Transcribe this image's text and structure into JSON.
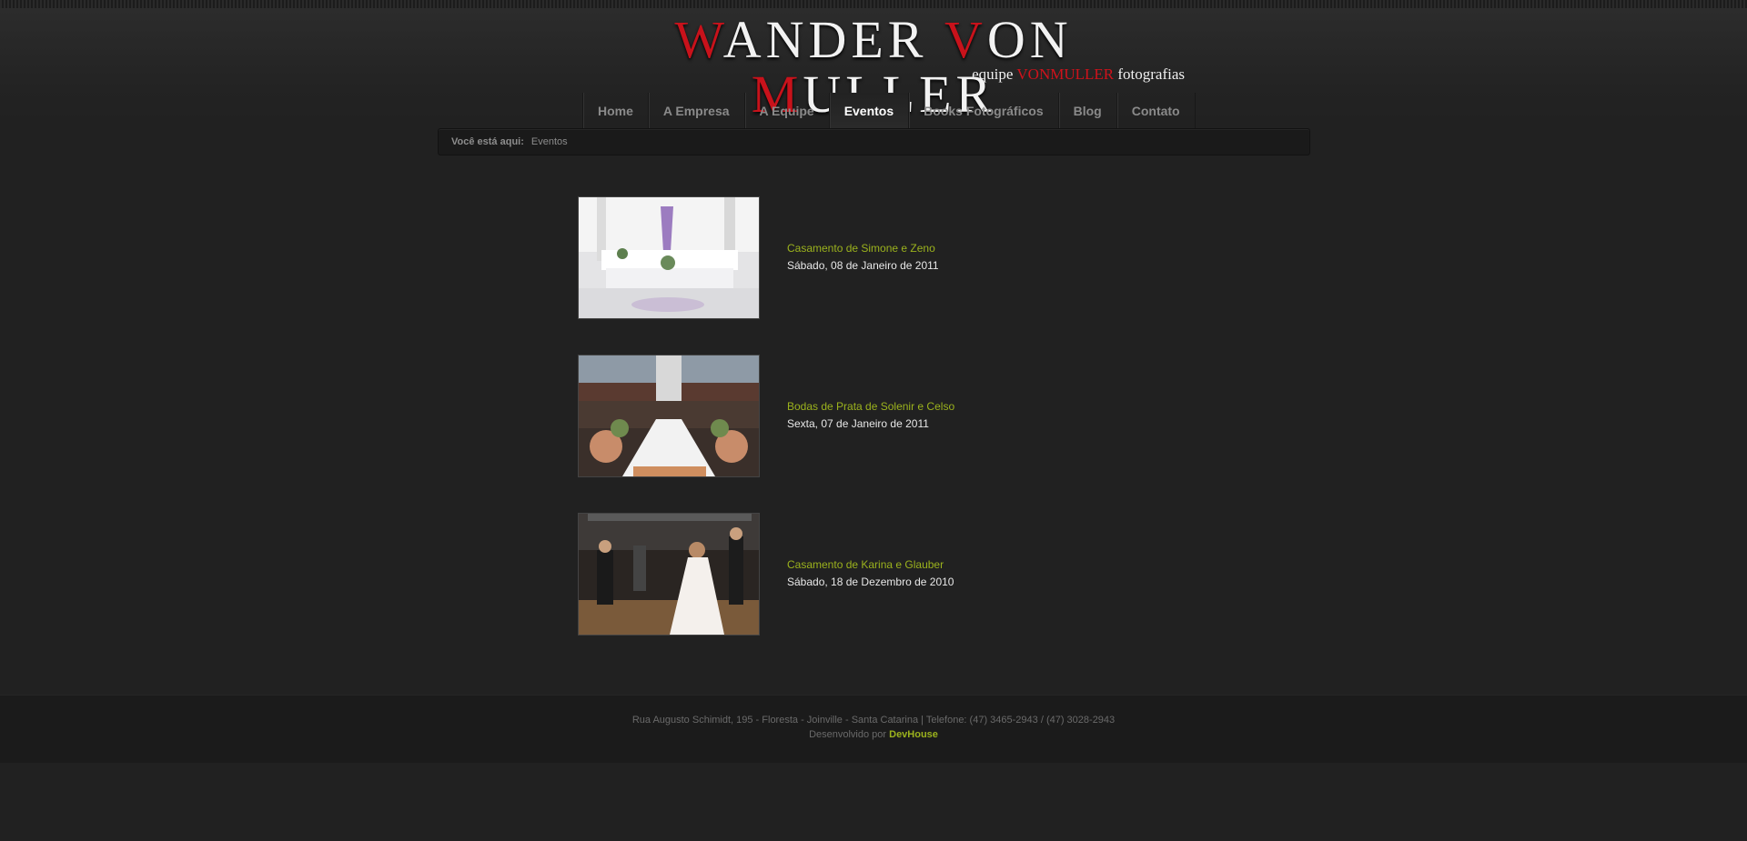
{
  "logo": {
    "title_parts": [
      {
        "cap": "W",
        "rest": "ANDER"
      },
      {
        "cap": "V",
        "rest": "ON"
      },
      {
        "cap": "M",
        "rest": "ULLER"
      }
    ],
    "subtitle_pre": "equipe ",
    "subtitle_brand": "VONMULLER",
    "subtitle_post": " fotografias"
  },
  "nav": {
    "items": [
      {
        "label": "Home"
      },
      {
        "label": "A Empresa"
      },
      {
        "label": "A Equipe"
      },
      {
        "label": "Eventos"
      },
      {
        "label": "Books Fotográficos"
      },
      {
        "label": "Blog"
      },
      {
        "label": "Contato"
      }
    ],
    "active": "Eventos"
  },
  "breadcrumb": {
    "label": "Você está aqui:",
    "current": "Eventos"
  },
  "events": [
    {
      "title": "Casamento de Simone e Zeno",
      "date": "Sábado, 08 de Janeiro de 2011"
    },
    {
      "title": "Bodas de Prata de Solenir e Celso",
      "date": "Sexta, 07 de Janeiro de 2011"
    },
    {
      "title": "Casamento de Karina e Glauber",
      "date": "Sábado, 18 de Dezembro de 2010"
    }
  ],
  "footer": {
    "address": "Rua Augusto Schimidt, 195 - Floresta - Joinville - Santa Catarina | Telefone: (47) 3465-2943 / (47) 3028-2943",
    "dev_prefix": "Desenvolvido por ",
    "dev_link": "DevHouse"
  },
  "colors": {
    "accent": "#9bb21d",
    "brand_red": "#c8121b",
    "background": "#212121"
  }
}
